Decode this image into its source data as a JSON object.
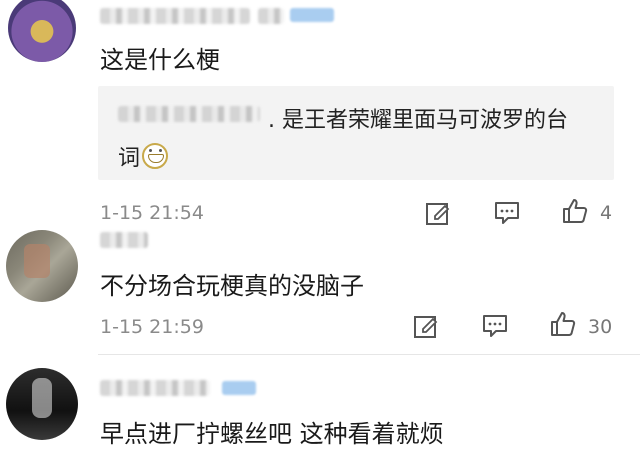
{
  "comments": [
    {
      "text": "这是什么梗",
      "reply": {
        "line1": ". 是王者荣耀里面马可波罗的台",
        "line2": "词"
      },
      "timestamp": "1-15 21:54",
      "likes": "4"
    },
    {
      "text": "不分场合玩梗真的没脑子",
      "timestamp": "1-15 21:59",
      "likes": "30"
    },
    {
      "text": "早点进厂拧螺丝吧 这种看着就烦"
    }
  ],
  "icons": {
    "edit": "edit-icon",
    "comment": "comment-icon",
    "like": "thumbs-up-icon",
    "emoji": "grin-emoji-icon"
  },
  "colors": {
    "reply_bg": "#f3f3f3",
    "meta_text": "#8a8a8a",
    "icon": "#555555"
  }
}
